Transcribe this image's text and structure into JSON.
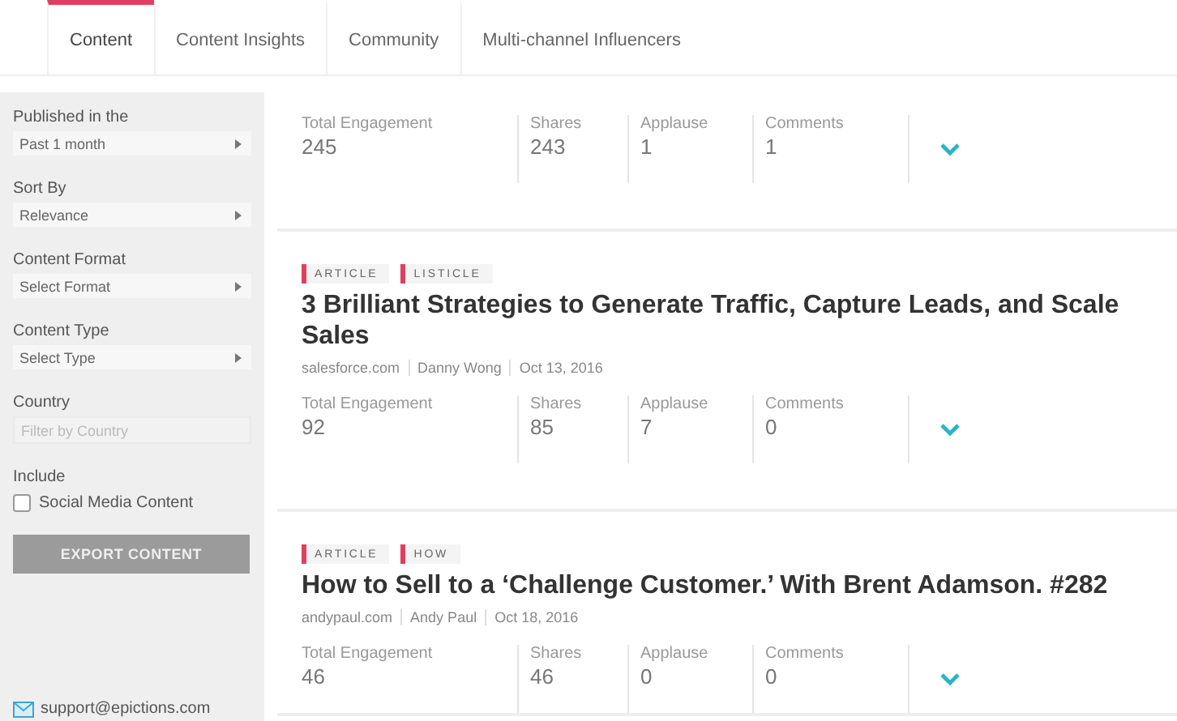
{
  "tabs": [
    {
      "label": "Content",
      "selected": true
    },
    {
      "label": "Content Insights",
      "selected": false
    },
    {
      "label": "Community",
      "selected": false
    },
    {
      "label": "Multi-channel Influencers",
      "selected": false
    }
  ],
  "sidebar": {
    "filters": [
      {
        "kind": "select",
        "label": "Published in the",
        "value": "Past 1 month"
      },
      {
        "kind": "select",
        "label": "Sort By",
        "value": "Relevance"
      },
      {
        "kind": "select",
        "label": "Content Format",
        "value": "Select Format"
      },
      {
        "kind": "select",
        "label": "Content Type",
        "value": "Select Type"
      },
      {
        "kind": "input",
        "label": "Country",
        "placeholder": "Filter by Country"
      }
    ],
    "include": {
      "label": "Include",
      "options": [
        {
          "label": "Social Media Content",
          "checked": false
        }
      ]
    },
    "export_button": "EXPORT CONTENT",
    "support_email": "support@epictions.com"
  },
  "articles": [
    {
      "stats": [
        {
          "label": "Total Engagement",
          "value": "245"
        },
        {
          "label": "Shares",
          "value": "243"
        },
        {
          "label": "Applause",
          "value": "1"
        },
        {
          "label": "Comments",
          "value": "1"
        }
      ]
    },
    {
      "tags": [
        "ARTICLE",
        "LISTICLE"
      ],
      "title": "3 Brilliant Strategies to Generate Traffic, Capture Leads, and Scale Sales",
      "meta": [
        "salesforce.com",
        "Danny Wong",
        "Oct 13, 2016"
      ],
      "stats": [
        {
          "label": "Total Engagement",
          "value": "92"
        },
        {
          "label": "Shares",
          "value": "85"
        },
        {
          "label": "Applause",
          "value": "7"
        },
        {
          "label": "Comments",
          "value": "0"
        }
      ]
    },
    {
      "tags": [
        "ARTICLE",
        "HOW"
      ],
      "title": "How to Sell to a ‘Challenge Customer.’ With Brent Adamson. #282",
      "meta": [
        "andypaul.com",
        "Andy Paul",
        "Oct 18, 2016"
      ],
      "stats": [
        {
          "label": "Total Engagement",
          "value": "46"
        },
        {
          "label": "Shares",
          "value": "46"
        },
        {
          "label": "Applause",
          "value": "0"
        },
        {
          "label": "Comments",
          "value": "0"
        }
      ]
    }
  ]
}
